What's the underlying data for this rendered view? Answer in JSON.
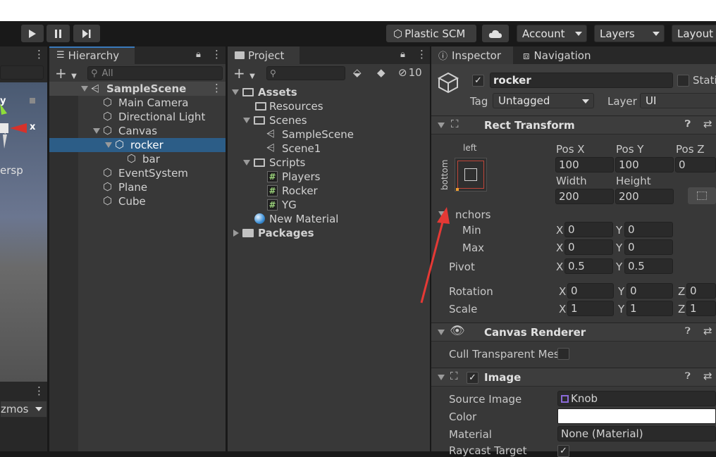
{
  "toolbar": {
    "cloud_service": "Plastic SCM",
    "account": "Account",
    "layers": "Layers",
    "layout": "Layout"
  },
  "scene": {
    "axis_y": "y",
    "axis_x": "x",
    "persp": "ersp",
    "gizmos": "zmos"
  },
  "hierarchy": {
    "title": "Hierarchy",
    "search_placeholder": "All",
    "items": [
      {
        "label": "SampleScene"
      },
      {
        "label": "Main Camera"
      },
      {
        "label": "Directional Light"
      },
      {
        "label": "Canvas"
      },
      {
        "label": "rocker"
      },
      {
        "label": "bar"
      },
      {
        "label": "EventSystem"
      },
      {
        "label": "Plane"
      },
      {
        "label": "Cube"
      }
    ]
  },
  "project": {
    "title": "Project",
    "hidden_count": "10",
    "items": [
      {
        "label": "Assets"
      },
      {
        "label": "Resources"
      },
      {
        "label": "Scenes"
      },
      {
        "label": "SampleScene"
      },
      {
        "label": "Scene1"
      },
      {
        "label": "Scripts"
      },
      {
        "label": "Players"
      },
      {
        "label": "Rocker"
      },
      {
        "label": "YG"
      },
      {
        "label": "New Material"
      },
      {
        "label": "Packages"
      }
    ]
  },
  "inspector": {
    "title": "Inspector",
    "nav_tab": "Navigation",
    "object_name": "rocker",
    "static_label": "Stati",
    "tag_label": "Tag",
    "tag_value": "Untagged",
    "layer_label": "Layer",
    "layer_value": "UI",
    "rect": {
      "title": "Rect Transform",
      "anchor_left": "left",
      "anchor_bottom": "bottom",
      "posx_label": "Pos X",
      "posy_label": "Pos Y",
      "posz_label": "Pos Z",
      "posx": "100",
      "posy": "100",
      "posz": "0",
      "width_label": "Width",
      "height_label": "Height",
      "width": "200",
      "height": "200",
      "anchors_label": "nchors",
      "min_label": "Min",
      "max_label": "Max",
      "min_x": "0",
      "min_y": "0",
      "max_x": "0",
      "max_y": "0",
      "pivot_label": "Pivot",
      "pivot_x": "0.5",
      "pivot_y": "0.5",
      "rotation_label": "Rotation",
      "rot_x": "0",
      "rot_y": "0",
      "rot_z": "0",
      "scale_label": "Scale",
      "scale_x": "1",
      "scale_y": "1",
      "scale_z": "1",
      "x": "X",
      "y": "Y",
      "z": "Z"
    },
    "canvas_renderer": {
      "title": "Canvas Renderer",
      "cull_label": "Cull Transparent Mes"
    },
    "image": {
      "title": "Image",
      "source_label": "Source Image",
      "source_value": "Knob",
      "color_label": "Color",
      "material_label": "Material",
      "material_value": "None (Material)",
      "raycast_label": "Raycast Target"
    }
  },
  "colors": {
    "selection": "#2c5d87",
    "tab_accent": "#3a79bb",
    "annotation_arrow": "#e53935"
  }
}
